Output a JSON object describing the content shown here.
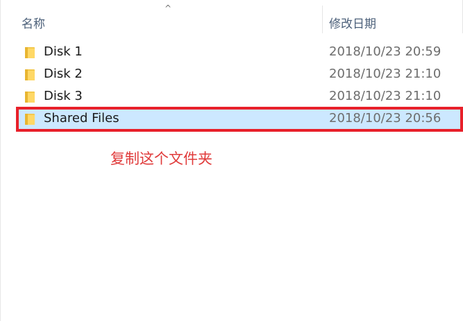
{
  "header": {
    "sort_indicator": "^",
    "col_name": "名称",
    "col_date_modified": "修改日期"
  },
  "files": [
    {
      "name": "Disk 1",
      "date_modified": "2018/10/23 20:59",
      "type": "folder",
      "selected": false
    },
    {
      "name": "Disk 2",
      "date_modified": "2018/10/23 21:10",
      "type": "folder",
      "selected": false
    },
    {
      "name": "Disk 3",
      "date_modified": "2018/10/23 21:10",
      "type": "folder",
      "selected": false
    },
    {
      "name": "Shared Files",
      "date_modified": "2018/10/23 20:56",
      "type": "folder",
      "selected": true
    }
  ],
  "annotation": {
    "text": "复制这个文件夹",
    "color": "#e03a3a",
    "box_color": "#e8202a"
  },
  "colors": {
    "selection_bg": "#cce8ff",
    "header_text": "#4c607a",
    "date_text": "#6d6d6d",
    "folder_yellow": "#f3c94d"
  },
  "icons": {
    "folder": "folder-icon",
    "sort": "sort-ascending-icon"
  }
}
